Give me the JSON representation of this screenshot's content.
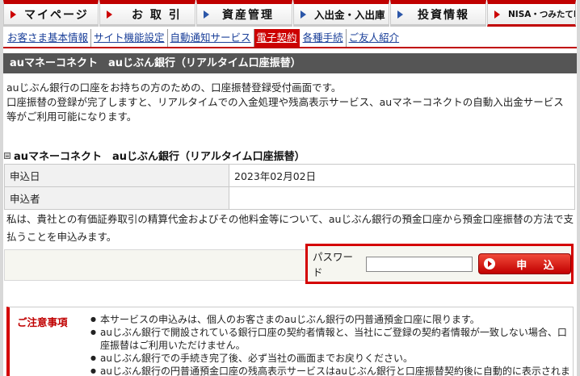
{
  "tabs": [
    {
      "label": "マイページ",
      "arrow": "red"
    },
    {
      "label": "お 取 引",
      "arrow": "red"
    },
    {
      "label": "資産管理",
      "arrow": "blue"
    },
    {
      "label": "入出金・入出庫",
      "arrow": "blue"
    },
    {
      "label": "投資情報",
      "arrow": "blue"
    },
    {
      "label": "NISA・つみたてNISA",
      "arrow": "red"
    }
  ],
  "subnav": [
    {
      "label": "お客さま基本情報"
    },
    {
      "label": "サイト機能設定"
    },
    {
      "label": "自動通知サービス"
    },
    {
      "label": "電子契約",
      "active": true
    },
    {
      "label": "各種手続"
    },
    {
      "label": "ご友人紹介"
    }
  ],
  "title": "auマネーコネクト　auじぶん銀行（リアルタイム口座振替）",
  "intro": [
    "auじぶん銀行の口座をお持ちの方のための、口座振替登録受付画面です。",
    "口座振替の登録が完了しますと、リアルタイムでの入金処理や残高表示サービス、auマネーコネクトの自動入出金サービス等がご利用可能になります。"
  ],
  "section_heading": "auマネーコネクト　auじぶん銀行（リアルタイム口座振替）",
  "table": [
    {
      "key": "申込日",
      "value": "2023年02月02日"
    },
    {
      "key": "申込者",
      "value": ""
    }
  ],
  "consent": "私は、貴社との有価証券取引の精算代金およびその他料金等について、auじぶん銀行の預金口座から預金口座振替の方法で支払うことを申込みます。",
  "password_label": "パスワード",
  "submit_label": "申 込",
  "notes": {
    "heading": "ご注意事項",
    "items": [
      "本サービスの申込みは、個人のお客さまのauじぶん銀行の円普通預金口座に限ります。",
      "auじぶん銀行で開設されている銀行口座の契約者情報と、当社にご登録の契約者情報が一致しない場合、口座振替はご利用いただけません。",
      "auじぶん銀行での手続き完了後、必ず当社の画面までお戻りください。",
      "auじぶん銀行の円普通預金口座の残高表示サービスはauじぶん銀行と口座振替契約後に自動的に表示されます。"
    ]
  },
  "colors": {
    "accent": "#cc0000",
    "title_bar": "#555555",
    "link": "#1a3f99"
  }
}
